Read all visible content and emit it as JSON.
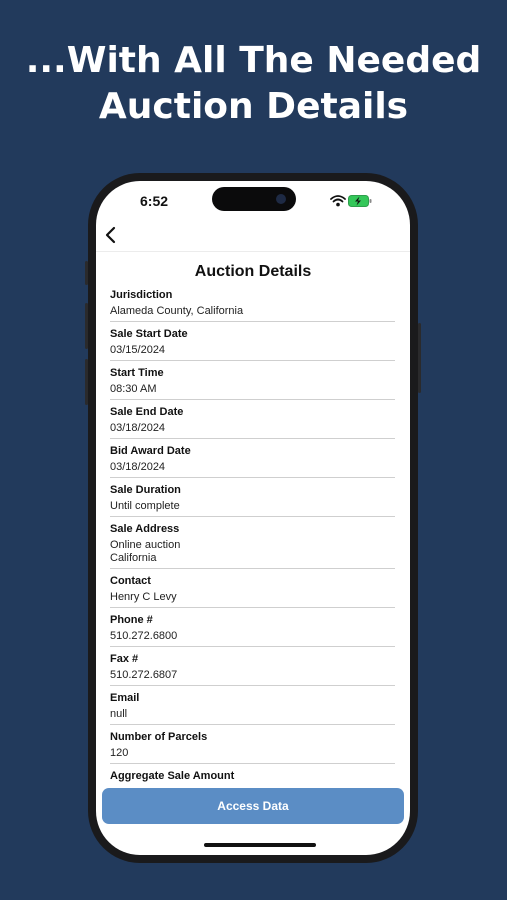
{
  "headline": {
    "line1": "...With All The Needed",
    "line2": "Auction Details"
  },
  "status_bar": {
    "time": "6:52",
    "icons": [
      "wifi-icon",
      "battery-charging-icon"
    ]
  },
  "nav": {
    "back_icon": "chevron-left-icon"
  },
  "screen_title": "Auction Details",
  "fields": [
    {
      "label": "Jurisdiction",
      "value": "Alameda County, California"
    },
    {
      "label": "Sale Start Date",
      "value": "03/15/2024"
    },
    {
      "label": "Start Time",
      "value": "08:30 AM"
    },
    {
      "label": "Sale End Date",
      "value": "03/18/2024"
    },
    {
      "label": "Bid Award Date",
      "value": "03/18/2024"
    },
    {
      "label": "Sale Duration",
      "value": "Until complete"
    },
    {
      "label": "Sale Address",
      "value": "Online auction\nCalifornia"
    },
    {
      "label": "Contact",
      "value": "Henry C Levy"
    },
    {
      "label": "Phone #",
      "value": "510.272.6800"
    },
    {
      "label": "Fax #",
      "value": "510.272.6807"
    },
    {
      "label": "Email",
      "value": "null"
    },
    {
      "label": "Number of Parcels",
      "value": "120"
    },
    {
      "label": "Aggregate Sale Amount",
      "value": ""
    }
  ],
  "access_button": {
    "label": "Access Data"
  },
  "colors": {
    "background": "#223a5c",
    "button": "#5b8dc5",
    "battery": "#34c759"
  }
}
